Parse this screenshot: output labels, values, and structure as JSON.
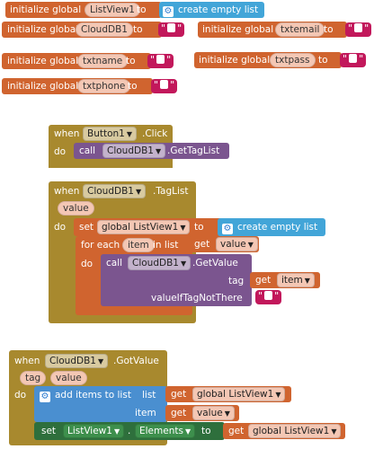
{
  "globals": [
    {
      "prefix": "initialize global",
      "name": "ListView1",
      "to": "to",
      "value": "create empty list"
    },
    {
      "prefix": "initialize global",
      "name": "CloudDB1",
      "to": "to",
      "value": "\" \""
    },
    {
      "prefix": "initialize global",
      "name": "txtemail",
      "to": "to",
      "value": "\" \""
    },
    {
      "prefix": "initialize global",
      "name": "txtname",
      "to": "to",
      "value": "\" \""
    },
    {
      "prefix": "initialize global",
      "name": "txtpass",
      "to": "to",
      "value": "\" \""
    },
    {
      "prefix": "initialize global",
      "name": "txtphone",
      "to": "to",
      "value": "\" \""
    }
  ],
  "event1": {
    "when": "when",
    "component": "Button1",
    "event": ".Click",
    "do": "do",
    "call": "call",
    "call_component": "CloudDB1",
    "method": ".GetTagList"
  },
  "event2": {
    "when": "when",
    "component": "CloudDB1",
    "event": ".TagList",
    "param": "value",
    "do": "do",
    "set": "set",
    "set_var": "global ListView1",
    "to": "to",
    "create_empty_list": "create empty list",
    "for_each": "for each",
    "item_var": "item",
    "in_list": "in list",
    "get": "get",
    "get_value": "value",
    "do2": "do",
    "call": "call",
    "call_component": "CloudDB1",
    "method": ".GetValue",
    "tag_label": "tag",
    "get_item": "item",
    "value_if_not_there": "valueIfTagNotThere"
  },
  "event3": {
    "when": "when",
    "component": "CloudDB1",
    "event": ".GotValue",
    "param_tag": "tag",
    "param_value": "value",
    "do": "do",
    "add_items": "add items to list",
    "list_label": "list",
    "get": "get",
    "get_listview": "global ListView1",
    "item_label": "item",
    "get_value": "value",
    "set": "set",
    "set_component": "ListView1",
    "set_prop_dot": ".",
    "set_property": "Elements",
    "to": "to"
  },
  "colors": {
    "variables": "#d0642f",
    "lists": "#42a5d8",
    "events": "#a8892e",
    "procedures": "#7b558f",
    "text": "#c2185b",
    "component_setter": "#2e6f3c"
  },
  "icons": {
    "mutator": "gear-icon",
    "dropdown": "dropdown-arrow-icon",
    "string_blank": "text-block-icon"
  }
}
